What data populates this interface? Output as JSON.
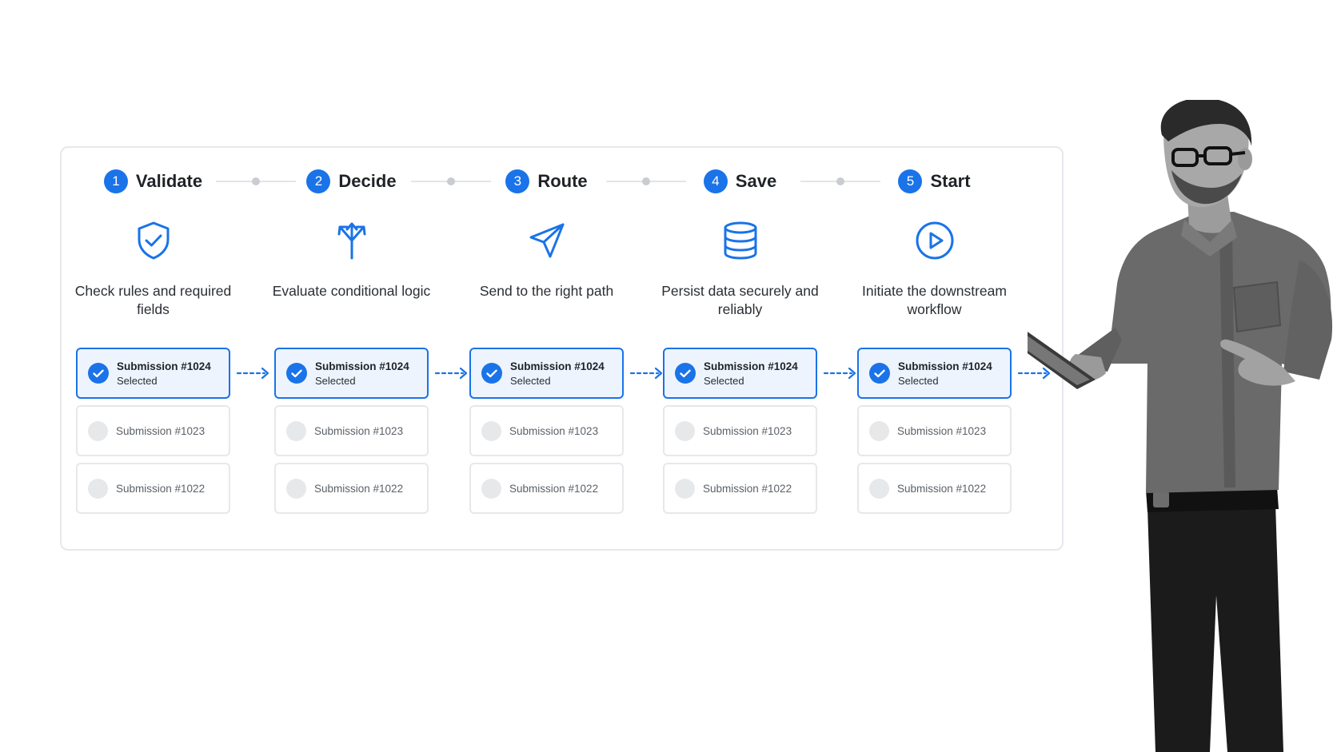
{
  "colors": {
    "accent": "#1a73e8",
    "border": "#e6e8ec",
    "selected_bg": "#eef4fe"
  },
  "steps": [
    {
      "number": "1",
      "title": "Validate",
      "icon": "shield-check-icon",
      "description": "Check rules and required fields",
      "cards": [
        {
          "label": "Submission #1024",
          "status": "Selected"
        },
        {
          "label": "Submission #1023"
        },
        {
          "label": "Submission #1022"
        }
      ]
    },
    {
      "number": "2",
      "title": "Decide",
      "icon": "split-arrows-icon",
      "description": "Evaluate conditional logic",
      "cards": [
        {
          "label": "Submission #1024",
          "status": "Selected"
        },
        {
          "label": "Submission #1023"
        },
        {
          "label": "Submission #1022"
        }
      ]
    },
    {
      "number": "3",
      "title": "Route",
      "icon": "paper-plane-icon",
      "description": "Send to the right path",
      "cards": [
        {
          "label": "Submission #1024",
          "status": "Selected"
        },
        {
          "label": "Submission #1023"
        },
        {
          "label": "Submission #1022"
        }
      ]
    },
    {
      "number": "4",
      "title": "Save",
      "icon": "database-icon",
      "description": "Persist data securely and reliably",
      "cards": [
        {
          "label": "Submission #1024",
          "status": "Selected"
        },
        {
          "label": "Submission #1023"
        },
        {
          "label": "Submission #1022"
        }
      ]
    },
    {
      "number": "5",
      "title": "Start",
      "icon": "play-circle-icon",
      "description": "Initiate the downstream workflow",
      "cards": [
        {
          "label": "Submission #1024",
          "status": "Selected"
        },
        {
          "label": "Submission #1023"
        },
        {
          "label": "Submission #1022"
        }
      ]
    }
  ],
  "illustration": {
    "subject": "person-with-tablet-icon"
  }
}
